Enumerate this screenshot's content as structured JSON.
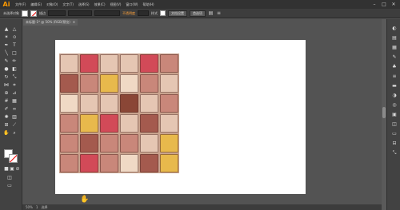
{
  "menubar": {
    "logo": "Ai",
    "items": [
      "文件(F)",
      "编辑(E)",
      "对象(O)",
      "文字(T)",
      "选择(S)",
      "效果(C)",
      "视图(V)",
      "窗口(W)",
      "帮助(H)"
    ],
    "window_buttons": [
      "–",
      "□",
      "✕"
    ]
  },
  "controlbar": {
    "selection_label": "未选择对象",
    "stroke_label": "描边",
    "stroke_value": "",
    "profile_value": "",
    "opacity_label": "不透明度",
    "style_label": "样式",
    "doc_setup_button": "文档设置",
    "prefs_button": "首选项"
  },
  "document": {
    "tab_label": "未标题-1* @ 50% (RGB/预览)",
    "tab_close": "✕"
  },
  "toolbar": {
    "fill_color": "#ffffff",
    "stroke_color": "#ffffff"
  },
  "canvas": {
    "artboard_color": "#ffffff",
    "image_description_colors": [
      "#e5c6b3",
      "#c9877a",
      "#a45a4e",
      "#e8b94c",
      "#d24a58",
      "#8a4636",
      "#f0d9c5"
    ]
  },
  "statusbar": {
    "zoom": "50%",
    "page": "1",
    "tool": "选择"
  }
}
